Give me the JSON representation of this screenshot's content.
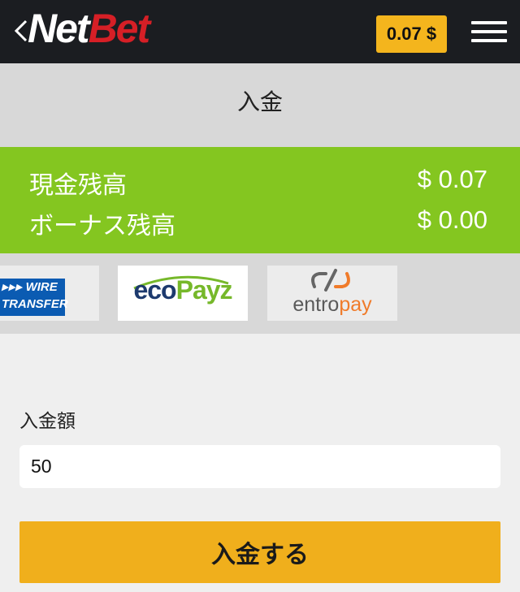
{
  "header": {
    "logo_part1": "Net",
    "logo_part2": "Bet",
    "balance_badge": "0.07 $",
    "icons": {
      "back": "chevron-left-icon",
      "menu": "hamburger-menu-icon"
    }
  },
  "page_title": "入金",
  "balances": {
    "cash_label": "現金残高",
    "cash_value": "$ 0.07",
    "bonus_label": "ボーナス残高",
    "bonus_value": "$ 0.00"
  },
  "payment_methods": {
    "wire_line1": "WIRE",
    "wire_line2": "TRANSFER",
    "eco_part1": "eco",
    "eco_part2": "Payz",
    "entro_part1": "entro",
    "entro_part2": "pay"
  },
  "form": {
    "amount_label": "入金額",
    "amount_value": "50",
    "submit_label": "入金する"
  },
  "colors": {
    "header_bg": "#1b1d21",
    "accent_yellow": "#f4b51d",
    "balance_green": "#84c620",
    "logo_red": "#d61f26"
  }
}
